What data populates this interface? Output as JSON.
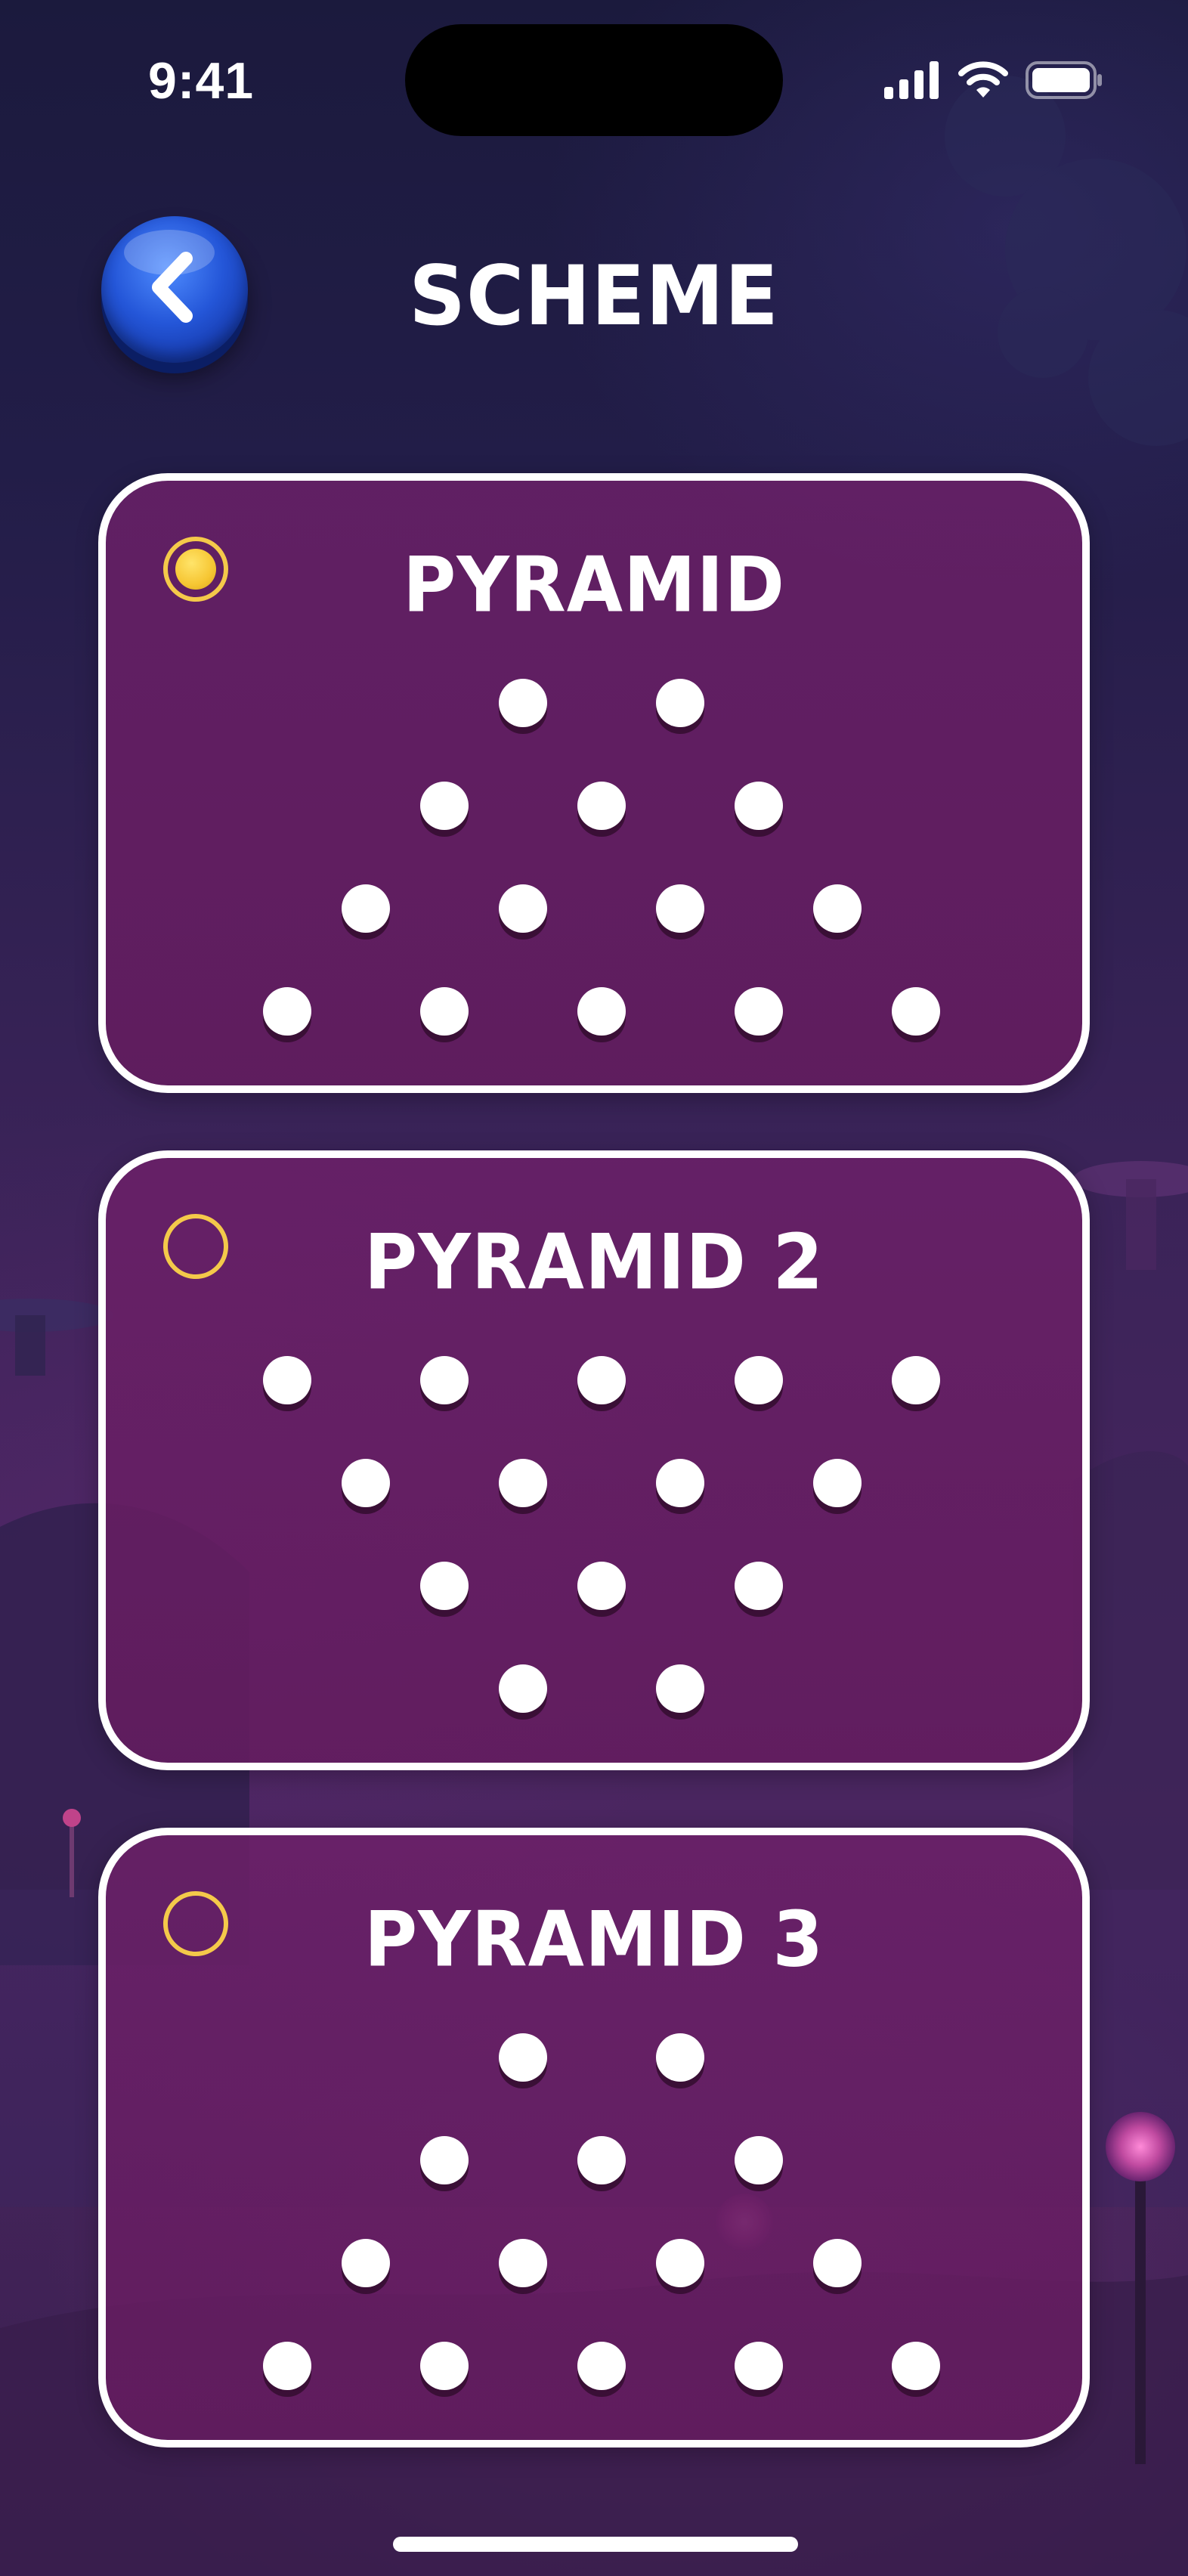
{
  "status_bar": {
    "time": "9:41",
    "icons": [
      "cellular-signal-icon",
      "wifi-icon",
      "battery-icon"
    ]
  },
  "header": {
    "back_icon": "chevron-left-icon",
    "title": "SCHEME"
  },
  "colors": {
    "card_fill": "#6a1f67",
    "card_border": "#ffffff",
    "radio_accent": "#f4c94a",
    "pin": "#ffffff",
    "back_button": "#2456d8"
  },
  "schemes": [
    {
      "title": "PYRAMID",
      "selected": true,
      "rows": [
        2,
        3,
        4,
        5
      ]
    },
    {
      "title": "PYRAMID 2",
      "selected": false,
      "rows": [
        5,
        4,
        3,
        2
      ]
    },
    {
      "title": "PYRAMID 3",
      "selected": false,
      "rows": [
        2,
        3,
        4,
        5
      ]
    }
  ]
}
